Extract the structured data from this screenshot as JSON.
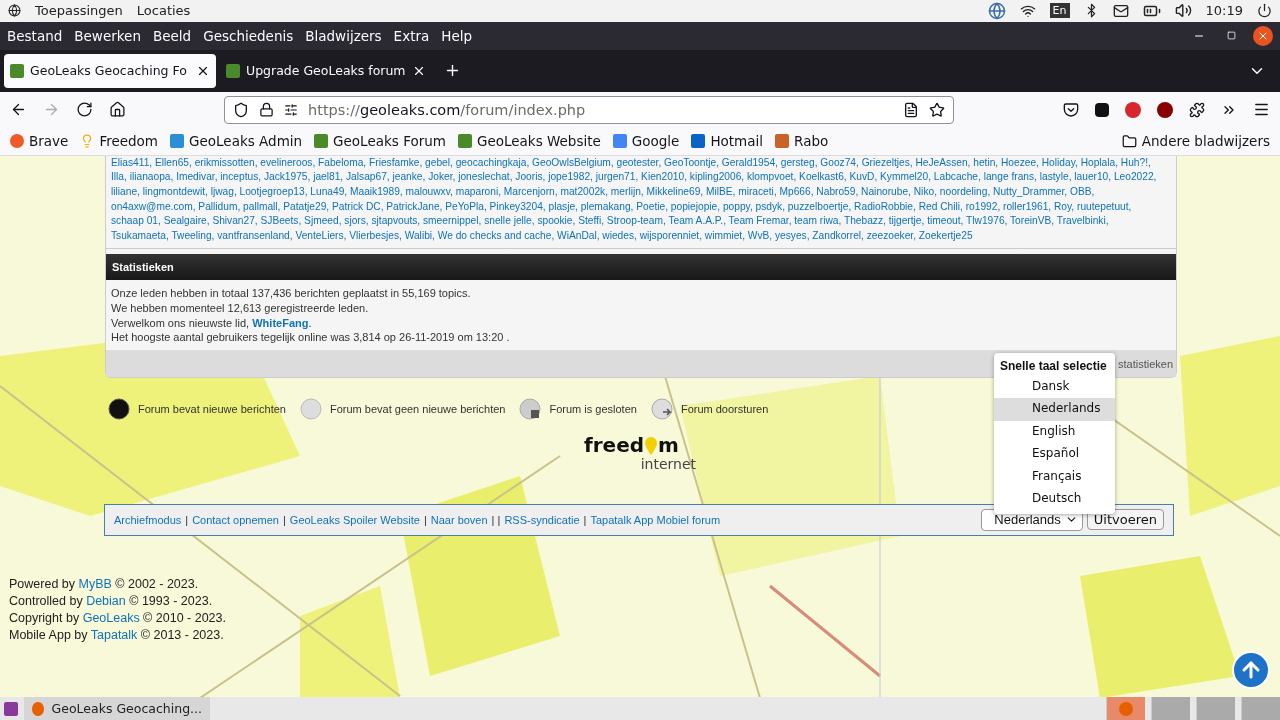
{
  "system_bar": {
    "apps": "Toepassingen",
    "places": "Locaties",
    "keyboard": "En",
    "time": "10:19"
  },
  "menu": [
    "Bestand",
    "Bewerken",
    "Beeld",
    "Geschiedenis",
    "Bladwijzers",
    "Extra",
    "Help"
  ],
  "tabs": [
    {
      "title": "GeoLeaks Geocaching Fo",
      "selected": true
    },
    {
      "title": "Upgrade GeoLeaks forum",
      "selected": false
    }
  ],
  "address": {
    "scheme": "https://",
    "host": "geoleaks.com",
    "path": "/forum/index.php"
  },
  "bookmarks": [
    "Brave",
    "Freedom",
    "GeoLeaks Admin",
    "GeoLeaks Forum",
    "GeoLeaks Website",
    "Google",
    "Hotmail",
    "Rabo"
  ],
  "other_bookmarks": "Andere bladwijzers",
  "online_users": [
    "Elias411, Ellen65, erikmissotten, evelineroos, Fabeloma, Friesfamke, gebel, geocachingkaja, GeoOwlsBelgium, geotester, GeoToontje, Gerald1954, gersteg, Gooz74, Griezeltjes, HeJeAssen, hetin, Hoezee, Holiday, Hoplala, Huh?!,",
    "Illa, ilianaopa, Imedivar, inceptus, Jack1975, jael81, Jalsap67, jeanke, Joker, joneslechat, Jooris, jope1982, jurgen71, Kien2010, kipling2006, klompvoet, Koelkast6, KuvD, Kymmel20, Labcache, lange frans, lastyle, lauer10, Leo2022,",
    "liliane, lingmontdewit, ljwag, Lootjegroep13, Luna49, Maaik1989, malouwxv, maparoni, Marcenjorn, mat2002k, merlijn, Mikkeline69, MilBE, miraceti, Mp666, Nabro59, Nainorube, Niko, noordeling, Nutty_Drammer, OBB,",
    "on4axw@me.com, Pallidum, pallmall, Patatje29, Patrick DC, PatrickJane, PeYoPla, Pinkey3204, plasje, plemakang, Poetie, popiejopie, poppy, psdyk, puzzelboertje, RadioRobbie, Red Chili, ro1992, roller1961, Roy, ruutepetuut,",
    "schaap 01, Sealgaire, Shivan27, SJBeets, Sjmeed, sjors, sjtapvouts, smeernippel, snelle jelle, spookie, Steffi, Stroop-team, Team A.A.P., Team Fremar, team riwa, Thebazz, tijgertje, timeout, Tlw1976, ToreinVB, Travelbinki,",
    "Tsukamaeta, Tweeling, vantfransenland, VenteLiers, Vlierbesjes, Walibi, We do checks and cache, WiAnDal, wiedes, wijsporenniet, wimmiet, WvB, yesyes, Zandkorrel, zeezoeker, Zoekertje25"
  ],
  "stats": {
    "title": "Statistieken",
    "lines": [
      {
        "before": "Onze leden hebben in totaal 137,436 berichten geplaatst in 55,169 topics."
      },
      {
        "before": "We hebben momenteel 12,613 geregistreerde leden."
      },
      {
        "before": "Verwelkom ons nieuwste lid, ",
        "link": "WhiteFang",
        "after": "."
      },
      {
        "before": "Het hoogste aantal gebruikers tegelijk online was 3,814 op 26-11-2019 om 13:20 ."
      }
    ],
    "footer_link": "statistieken"
  },
  "legend": [
    {
      "kind": "new",
      "label": "Forum bevat nieuwe berichten"
    },
    {
      "kind": "none",
      "label": "Forum bevat geen nieuwe berichten"
    },
    {
      "kind": "locked",
      "label": "Forum is gesloten"
    },
    {
      "kind": "redirect",
      "label": "Forum doorsturen"
    }
  ],
  "logo": {
    "before": "freed",
    "after": "m",
    "subtitle": "internet"
  },
  "footer_links": [
    {
      "kind": "link",
      "text": "Archiefmodus"
    },
    {
      "kind": "separator",
      "text": "|"
    },
    {
      "kind": "link",
      "text": "Contact opnemen"
    },
    {
      "kind": "separator",
      "text": "|"
    },
    {
      "kind": "link",
      "text": "GeoLeaks Spoiler Website"
    },
    {
      "kind": "separator",
      "text": "|"
    },
    {
      "kind": "link",
      "text": "Naar boven"
    },
    {
      "kind": "separator",
      "text": "| |"
    },
    {
      "kind": "link",
      "text": "RSS-syndicatie"
    },
    {
      "kind": "separator",
      "text": "|"
    },
    {
      "kind": "link",
      "text": "Tapatalk App Mobiel forum"
    }
  ],
  "language": {
    "value": "Nederlands",
    "button": "Uitvoeren",
    "menu_title": "Snelle taal selectie",
    "options": [
      {
        "label": "Dansk",
        "selected": false
      },
      {
        "label": "Nederlands",
        "selected": true
      },
      {
        "label": "English",
        "selected": false
      },
      {
        "label": "Español",
        "selected": false
      },
      {
        "label": "Français",
        "selected": false
      },
      {
        "label": "Deutsch",
        "selected": false
      }
    ]
  },
  "credits": [
    {
      "before": "Powered by ",
      "link": "MyBB",
      "after": " © 2002 - 2023."
    },
    {
      "before": "Controlled by ",
      "link": "Debian",
      "after": " © 1993 - 2023."
    },
    {
      "before": "Copyright by ",
      "link": "GeoLeaks",
      "after": " © 2010 - 2023."
    },
    {
      "before": "Mobile App by ",
      "link": "Tapatalk",
      "after": " © 2013 - 2023."
    }
  ],
  "taskbar": {
    "window": "GeoLeaks Geocaching..."
  }
}
